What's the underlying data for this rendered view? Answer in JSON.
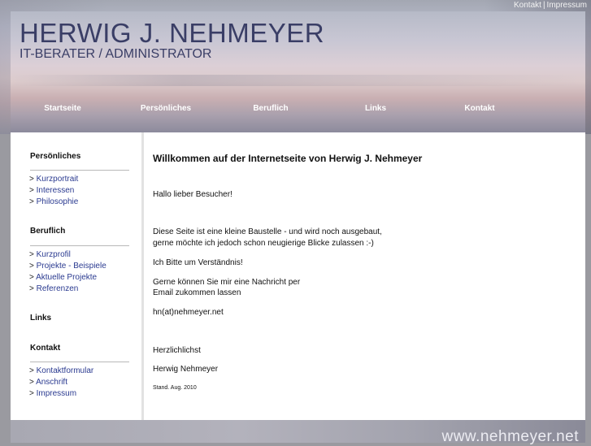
{
  "top_links": {
    "kontakt": "Kontakt",
    "separator": "|",
    "impressum": "Impressum"
  },
  "header": {
    "title": "HERWIG J. NEHMEYER",
    "subtitle": "IT-BERATER / ADMINISTRATOR"
  },
  "nav": [
    {
      "label": "Startseite"
    },
    {
      "label": "Persönliches"
    },
    {
      "label": "Beruflich"
    },
    {
      "label": "Links"
    },
    {
      "label": "Kontakt"
    }
  ],
  "sidebar": {
    "prefix": "> ",
    "sections": [
      {
        "title": "Persönliches",
        "items": [
          "Kurzportrait",
          "Interessen",
          "Philosophie"
        ]
      },
      {
        "title": "Beruflich",
        "items": [
          "Kurzprofil",
          "Projekte - Beispiele",
          "Aktuelle Projekte",
          "Referenzen"
        ]
      },
      {
        "title": "Links",
        "items": []
      },
      {
        "title": "Kontakt",
        "items": [
          "Kontaktformular",
          "Anschrift",
          "Impressum"
        ]
      }
    ]
  },
  "content": {
    "title": "Willkommen auf der Internetseite von Herwig J. Nehmeyer",
    "greeting": "Hallo lieber Besucher!",
    "p1_line1": "Diese Seite ist eine kleine Baustelle - und wird noch ausgebaut,",
    "p1_line2": "gerne möchte ich jedoch schon neugierige Blicke zulassen :-)",
    "p2": "Ich Bitte um Verständnis!",
    "p3_line1": "Gerne können Sie mir eine Nachricht per",
    "p3_line2": "Email zukommen lassen",
    "email": "hn(at)nehmeyer.net",
    "closing": "Herzlichlichst",
    "signature": "Herwig Nehmeyer",
    "stand": "Stand. Aug. 2010"
  },
  "footer": {
    "url": "www.nehmeyer.net"
  },
  "colors": {
    "title_color": "#3a3e66",
    "link_color": "#2a3a90",
    "nav_text": "#ffffff"
  }
}
